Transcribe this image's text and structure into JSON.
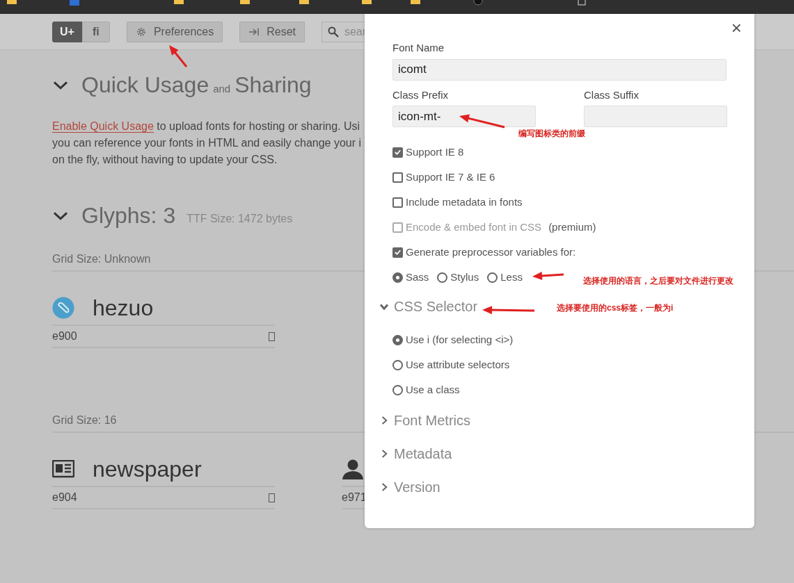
{
  "toolbar": {
    "view_toggle": [
      {
        "label": "U+",
        "selected": true
      },
      {
        "label": "fi",
        "selected": false
      }
    ],
    "buttons": [
      {
        "label": "Preferences",
        "kind": "gear"
      },
      {
        "label": "Reset",
        "kind": "reset"
      }
    ],
    "search": {
      "placeholder": "sear"
    }
  },
  "quick_usage": {
    "expanded": true,
    "title": [
      "Quick Usage",
      "and",
      "Sharing"
    ],
    "link": "Enable Quick Usage",
    "lines": [
      "to upload fonts for hosting or sharing. Usi",
      "you can reference your fonts in HTML and easily change your i",
      "on the fly, without having to update your CSS."
    ]
  },
  "glyphs": {
    "expanded": true,
    "title": "Glyphs: 3",
    "ttf_size": "TTF Size: 1472 bytes",
    "groups": [
      {
        "grid_size": "Grid Size: Unknown",
        "items": [
          {
            "kind": "badge",
            "name": "hezuo",
            "code": "e900"
          }
        ]
      },
      {
        "grid_size": "Grid Size: 16",
        "items": [
          {
            "kind": "newspaper",
            "name": "newspaper",
            "code": "e904"
          },
          {
            "kind": "person",
            "code": "e971"
          }
        ]
      }
    ]
  },
  "dialog": {
    "close": "×",
    "font_name": {
      "label": "Font Name",
      "value": "icomt"
    },
    "class_prefix": {
      "label": "Class Prefix",
      "value": "icon-mt-"
    },
    "class_suffix": {
      "label": "Class Suffix"
    },
    "options": [
      {
        "label": "Support IE 8",
        "checked": true,
        "disabled": false
      },
      {
        "label": "Support IE 7 & IE 6",
        "checked": false,
        "disabled": false
      },
      {
        "label": "Include metadata in fonts",
        "checked": false,
        "disabled": false
      },
      {
        "label": "Encode & embed font in CSS",
        "note": "(premium)",
        "checked": false,
        "disabled": true
      },
      {
        "label": "Generate preprocessor variables for:",
        "checked": true,
        "disabled": false
      }
    ],
    "preprocessors": [
      {
        "label": "Sass",
        "selected": true
      },
      {
        "label": "Stylus",
        "selected": false
      },
      {
        "label": "Less",
        "selected": false
      }
    ],
    "sections": [
      {
        "title": "CSS Selector",
        "expanded": true,
        "options": [
          {
            "label": "Use i (for selecting <i>)",
            "selected": true
          },
          {
            "label": "Use attribute selectors",
            "selected": false
          },
          {
            "label": "Use a class",
            "selected": false
          }
        ]
      },
      {
        "title": "Font Metrics",
        "expanded": false
      },
      {
        "title": "Metadata",
        "expanded": false
      },
      {
        "title": "Version",
        "expanded": false
      }
    ]
  },
  "annotations": [
    {
      "text": "编写图标类的前缀"
    },
    {
      "text": "选择使用的语言，之后要对文件进行更改"
    },
    {
      "text": "选择要使用的css标签，一般为i"
    }
  ]
}
